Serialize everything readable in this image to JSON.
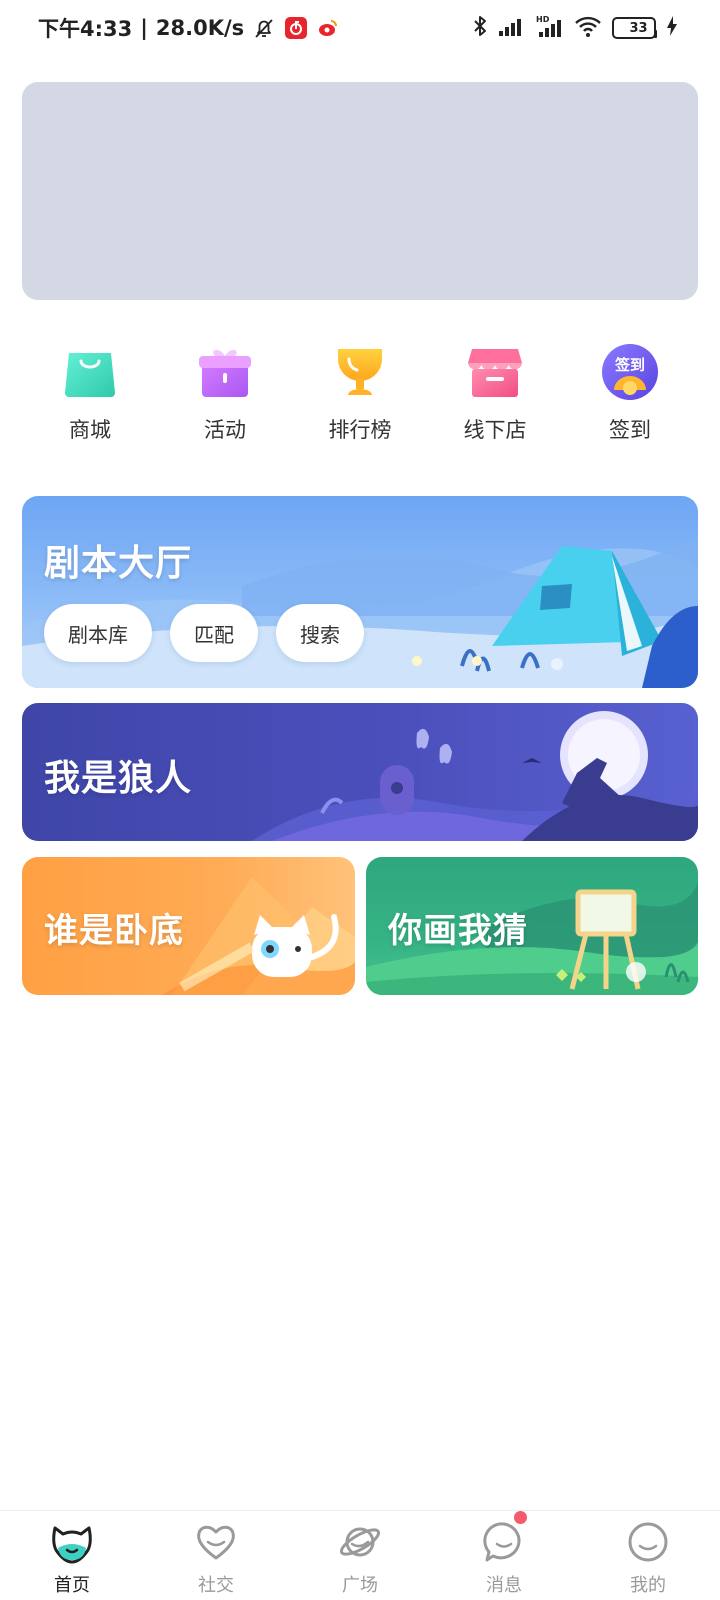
{
  "status_bar": {
    "time": "下午4:33",
    "separator": "|",
    "net_speed": "28.0K/s",
    "battery_level": "33",
    "icons": [
      "bell-off-icon",
      "netease-music-icon",
      "weibo-icon",
      "bluetooth-icon",
      "signal-icon",
      "hd-signal-icon",
      "wifi-icon",
      "battery-icon",
      "charging-icon"
    ]
  },
  "quick_nav": {
    "items": [
      {
        "label": "商城",
        "icon": "shopping-bag-icon"
      },
      {
        "label": "活动",
        "icon": "gift-box-icon"
      },
      {
        "label": "排行榜",
        "icon": "trophy-icon"
      },
      {
        "label": "线下店",
        "icon": "store-icon"
      },
      {
        "label": "签到",
        "icon": "checkin-icon",
        "icon_text": "签到"
      }
    ]
  },
  "cards": {
    "script_hall": {
      "title": "剧本大厅",
      "buttons": [
        "剧本库",
        "匹配",
        "搜索"
      ]
    },
    "werewolf": {
      "title": "我是狼人"
    },
    "undercover": {
      "title": "谁是卧底"
    },
    "draw_guess": {
      "title": "你画我猜"
    }
  },
  "tab_bar": {
    "active": 0,
    "items": [
      {
        "label": "首页",
        "icon": "cat-home-icon"
      },
      {
        "label": "社交",
        "icon": "heart-icon"
      },
      {
        "label": "广场",
        "icon": "planet-icon"
      },
      {
        "label": "消息",
        "icon": "chat-bubble-icon",
        "badge": true
      },
      {
        "label": "我的",
        "icon": "smiley-face-icon"
      }
    ]
  },
  "colors": {
    "banner_placeholder": "#d3d8e4",
    "script_card": "#6ea6f4",
    "werewolf_card": "#4b4fbc",
    "undercover_card": "#ffa043",
    "draw_card": "#36b384",
    "badge": "#f45b6b",
    "home_accent": "#3ed1c3"
  }
}
